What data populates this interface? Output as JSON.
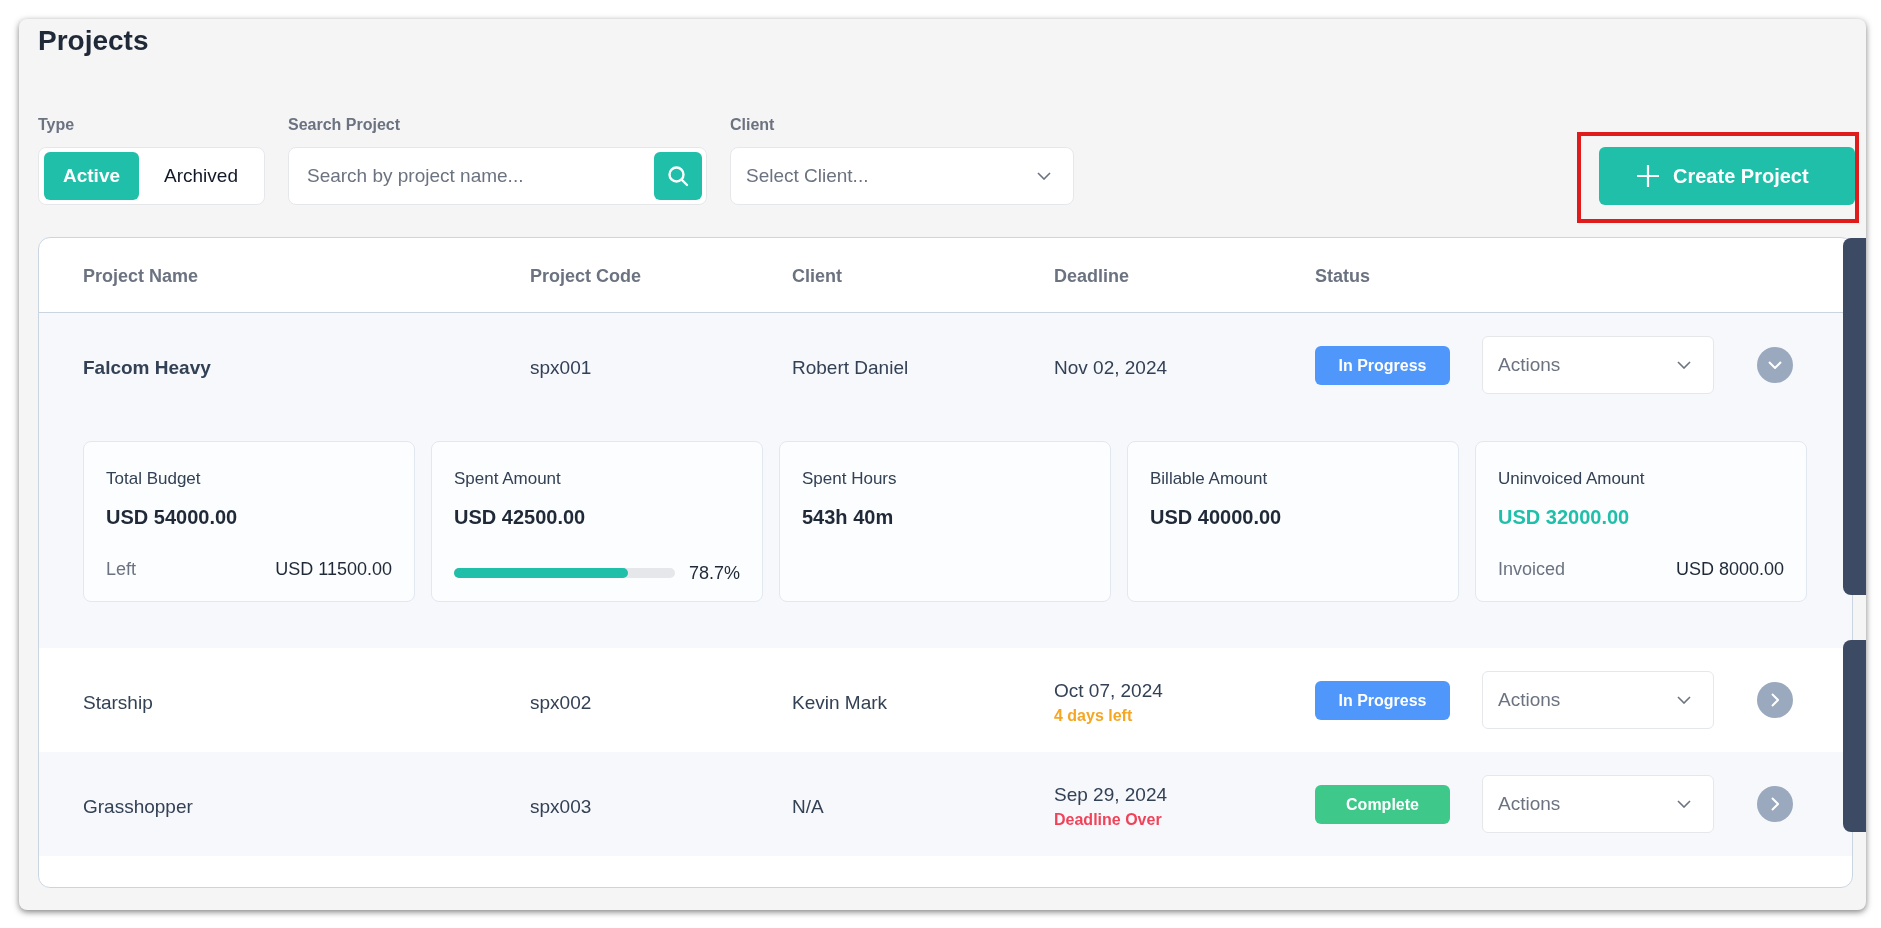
{
  "title": "Projects",
  "filters": {
    "type": {
      "label": "Type",
      "options": [
        {
          "label": "Active",
          "selected": true
        },
        {
          "label": "Archived",
          "selected": false
        }
      ]
    },
    "search": {
      "label": "Search Project",
      "placeholder": "Search by project name..."
    },
    "client": {
      "label": "Client",
      "placeholder": "Select Client..."
    }
  },
  "create_button": {
    "label": "Create Project",
    "highlighted": true
  },
  "table": {
    "columns": [
      "Project Name",
      "Project Code",
      "Client",
      "Deadline",
      "Status"
    ],
    "rows": [
      {
        "name": "Falcom Heavy",
        "code": "spx001",
        "client": "Robert Daniel",
        "deadline": "Nov 02, 2024",
        "status": {
          "label": "In Progress",
          "kind": "progress"
        },
        "actions": "Actions",
        "expanded": true,
        "details": [
          {
            "title": "Total Budget",
            "value": "USD 54000.00",
            "accent": false,
            "footer": {
              "label": "Left",
              "value": "USD 11500.00"
            }
          },
          {
            "title": "Spent Amount",
            "value": "USD 42500.00",
            "accent": false,
            "bar": {
              "level": 0.787,
              "reading": "78.7%"
            }
          },
          {
            "title": "Spent Hours",
            "value": "543h 40m",
            "accent": false
          },
          {
            "title": "Billable Amount",
            "value": "USD 40000.00",
            "accent": false
          },
          {
            "title": "Uninvoiced Amount",
            "value": "USD 32000.00",
            "accent": true,
            "footer": {
              "label": "Invoiced",
              "value": "USD 8000.00"
            }
          }
        ]
      },
      {
        "name": "Starship",
        "code": "spx002",
        "client": "Kevin Mark",
        "deadline": "Oct 07, 2024",
        "deadline_note": {
          "text": "4 days left",
          "kind": "warning"
        },
        "status": {
          "label": "In Progress",
          "kind": "progress"
        },
        "actions": "Actions",
        "expanded": false
      },
      {
        "name": "Grasshopper",
        "code": "spx003",
        "client": "N/A",
        "deadline": "Sep 29, 2024",
        "deadline_note": {
          "text": "Deadline Over",
          "kind": "overdue"
        },
        "status": {
          "label": "Complete",
          "kind": "complete"
        },
        "actions": "Actions",
        "expanded": false
      }
    ]
  }
}
